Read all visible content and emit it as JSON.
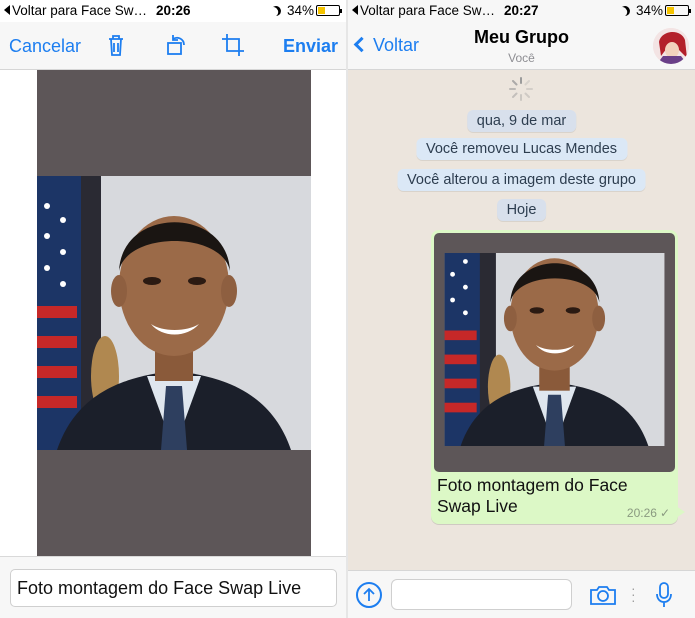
{
  "left": {
    "status": {
      "back": "Voltar para Face Sw…",
      "time": "20:26",
      "battery": "34%"
    },
    "toolbar": {
      "cancel": "Cancelar",
      "send": "Enviar",
      "icons": [
        "trash-icon",
        "rotate-icon",
        "crop-icon"
      ]
    },
    "caption": "Foto montagem do Face Swap Live"
  },
  "right": {
    "status": {
      "back": "Voltar para Face Sw…",
      "time": "20:27",
      "battery": "34%"
    },
    "header": {
      "back": "Voltar",
      "title": "Meu Grupo",
      "subtitle": "Você"
    },
    "system_messages": [
      "qua, 9 de mar",
      "Você removeu Lucas Mendes",
      "Você alterou a imagem deste grupo",
      "Hoje"
    ],
    "message": {
      "caption": "Foto montagem do Face Swap Live",
      "time": "20:26"
    },
    "input_bar": {
      "icons": [
        "upload-icon",
        "camera-icon",
        "mic-icon"
      ]
    }
  },
  "colors": {
    "accent": "#1d7ef0",
    "bubble": "#dcf8c6",
    "chat_bg": "#ece5dd",
    "photo_bg": "#5d5658"
  }
}
